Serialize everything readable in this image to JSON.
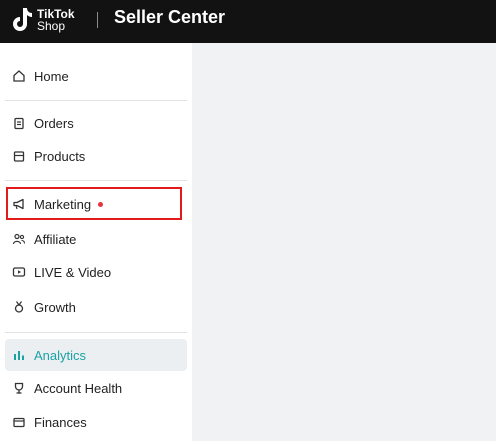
{
  "header": {
    "logo_line1": "TikTok",
    "logo_line2": "Shop",
    "app_title": "Seller Center"
  },
  "sidebar": {
    "items": [
      {
        "label": "Home",
        "icon": "home-icon"
      },
      {
        "label": "Orders",
        "icon": "clipboard-icon"
      },
      {
        "label": "Products",
        "icon": "box-icon"
      },
      {
        "label": "Marketing",
        "icon": "megaphone-icon",
        "badge": "red-dot"
      },
      {
        "label": "Affiliate",
        "icon": "people-icon"
      },
      {
        "label": "LIVE & Video",
        "icon": "video-icon"
      },
      {
        "label": "Growth",
        "icon": "medal-icon"
      },
      {
        "label": "Analytics",
        "icon": "bar-chart-icon",
        "active": true
      },
      {
        "label": "Account Health",
        "icon": "trophy-icon"
      },
      {
        "label": "Finances",
        "icon": "wallet-icon"
      }
    ]
  },
  "colors": {
    "topbar": "#121212",
    "active_text": "#1aa3a3",
    "highlight_border": "#e31a1a",
    "dot": "#e8323c"
  }
}
